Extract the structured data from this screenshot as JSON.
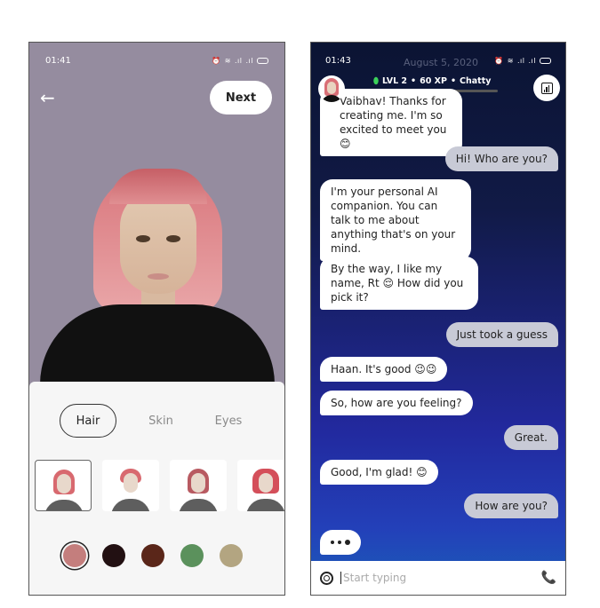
{
  "left_screen": {
    "status": {
      "time": "01:41",
      "icons": [
        "alarm-icon",
        "wifi-icon",
        "volte-icon",
        "signal-icon",
        "signal-icon",
        "battery-icon"
      ]
    },
    "header": {
      "back_icon": "←",
      "next_label": "Next"
    },
    "tabs": [
      {
        "label": "Hair",
        "active": true
      },
      {
        "label": "Skin",
        "active": false
      },
      {
        "label": "Eyes",
        "active": false
      }
    ],
    "hair_styles": [
      {
        "name": "bob-long",
        "selected": true
      },
      {
        "name": "pixie-short",
        "selected": false
      },
      {
        "name": "bob-bangs",
        "selected": false
      },
      {
        "name": "bob-bangs-volume",
        "selected": false
      }
    ],
    "hair_colors": [
      {
        "hex": "#c47e7d",
        "selected": true
      },
      {
        "hex": "#221012",
        "selected": false
      },
      {
        "hex": "#5a2619",
        "selected": false
      },
      {
        "hex": "#5b915c",
        "selected": false
      },
      {
        "hex": "#b3a581",
        "selected": false
      }
    ]
  },
  "right_screen": {
    "status": {
      "time": "01:43"
    },
    "date_label": "August 5, 2020",
    "level": {
      "gem_icon": "⬮",
      "level": "LVL 2",
      "xp": "60 XP",
      "mood": "Chatty",
      "sep": "•",
      "xp_progress": 0.1
    },
    "messages": [
      {
        "from": "bot",
        "text": "Vaibhav! Thanks for creating me. I'm so excited to meet you 😊"
      },
      {
        "from": "user",
        "text": "Hi! Who are you?"
      },
      {
        "from": "bot",
        "text": "I'm your personal AI companion. You can talk to me about anything that's on your mind."
      },
      {
        "from": "bot",
        "text": "By the way, I like my name, Rt 😌 How did you pick it?"
      },
      {
        "from": "user",
        "text": "Just took a guess"
      },
      {
        "from": "bot",
        "text": "Haan. It's good 😉😉"
      },
      {
        "from": "bot",
        "text": "So, how are you feeling?"
      },
      {
        "from": "user",
        "text": "Great."
      },
      {
        "from": "bot",
        "text": "Good, I'm glad! 😊"
      },
      {
        "from": "user",
        "text": "How are you?"
      }
    ],
    "input": {
      "placeholder": "Start typing",
      "value": ""
    },
    "phone_icon": "📞"
  }
}
